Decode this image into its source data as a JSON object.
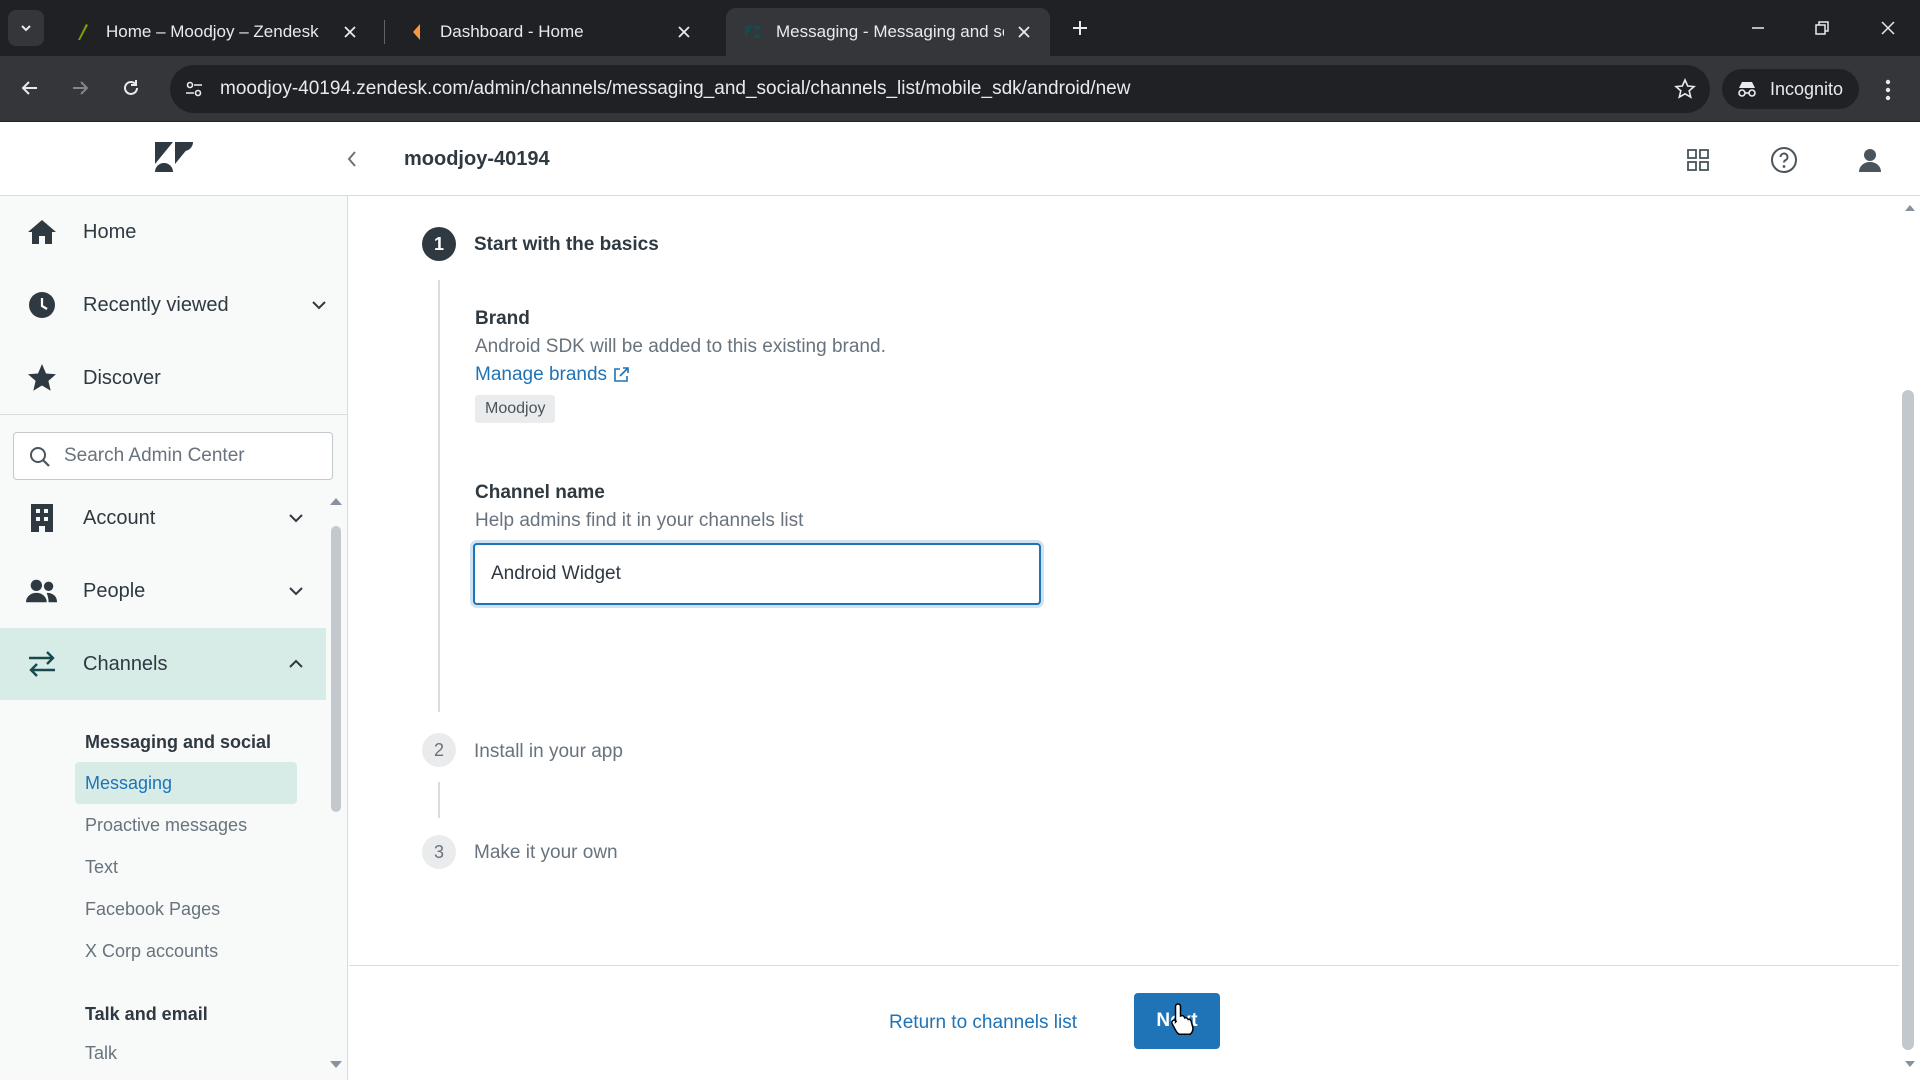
{
  "browser": {
    "tabs": [
      {
        "title": "Home – Moodjoy – Zendesk",
        "favicon": "zendesk-leaf-icon",
        "favicon_color": "#78a300"
      },
      {
        "title": "Dashboard - Home",
        "favicon": "dashboard-icon",
        "favicon_color": "#f79a3e"
      },
      {
        "title": "Messaging - Messaging and social",
        "favicon": "zendesk-icon",
        "favicon_color": "#17494d"
      }
    ],
    "url": "moodjoy-40194.zendesk.com/admin/channels/messaging_and_social/channels_list/mobile_sdk/android/new",
    "incognito_label": "Incognito"
  },
  "header": {
    "subdomain": "moodjoy-40194"
  },
  "sidebar": {
    "top_items": [
      {
        "label": "Home",
        "icon": "home-icon"
      },
      {
        "label": "Recently viewed",
        "icon": "clock-icon"
      },
      {
        "label": "Discover",
        "icon": "star-icon"
      }
    ],
    "search_placeholder": "Search Admin Center",
    "sections": [
      {
        "label": "Account",
        "icon": "building-icon"
      },
      {
        "label": "People",
        "icon": "people-icon"
      },
      {
        "label": "Channels",
        "icon": "channels-icon"
      }
    ],
    "sub_header_1": "Messaging and social",
    "sub_items": [
      "Messaging",
      "Proactive messages",
      "Text",
      "Facebook Pages",
      "X Corp accounts"
    ],
    "sub_header_2": "Talk and email",
    "sub_items_2": [
      "Talk"
    ]
  },
  "wizard": {
    "steps": [
      {
        "number": "1",
        "label": "Start with the basics"
      },
      {
        "number": "2",
        "label": "Install in your app"
      },
      {
        "number": "3",
        "label": "Make it your own"
      }
    ],
    "brand_label": "Brand",
    "brand_hint": "Android SDK will be added to this existing brand.",
    "manage_brands_link": "Manage brands",
    "brand_tag": "Moodjoy",
    "channel_name_label": "Channel name",
    "channel_name_hint": "Help admins find it in your channels list",
    "channel_name_value": "Android Widget"
  },
  "footer": {
    "return_link": "Return to channels list",
    "next_button": "Next"
  },
  "colors": {
    "accent": "#1f73b7",
    "active_bg": "#d8ece7",
    "browser_dark": "#202124"
  }
}
